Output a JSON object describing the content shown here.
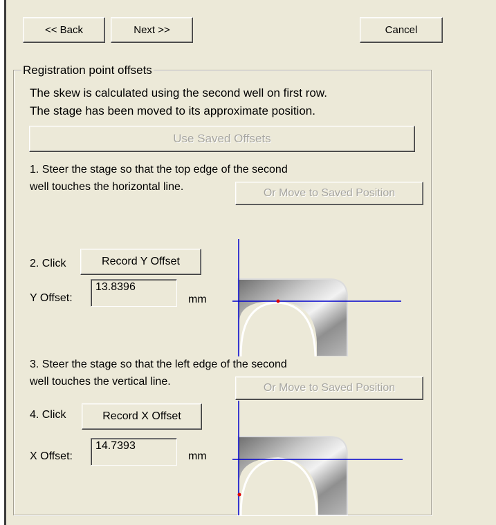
{
  "nav": {
    "back_label": "<< Back",
    "next_label": "Next >>",
    "cancel_label": "Cancel"
  },
  "group": {
    "title": "Registration point offsets",
    "intro_line1": "The skew is calculated using the second well on first row.",
    "intro_line2": "The stage has been moved to its approximate position.",
    "use_saved_label": "Use Saved Offsets"
  },
  "step1": {
    "line1": "1. Steer the stage so that the top edge of the second",
    "line2": "well touches the horizontal line.",
    "move_saved_label": "Or Move to Saved Position"
  },
  "step2": {
    "click_label": "2. Click",
    "record_label": "Record Y Offset",
    "offset_label": "Y Offset:",
    "offset_value": "13.8396",
    "unit": "mm"
  },
  "step3": {
    "line1": "3. Steer the stage so that the left edge of the second",
    "line2": "well touches the vertical line.",
    "move_saved_label": "Or Move to Saved Position"
  },
  "step4": {
    "click_label": "4. Click",
    "record_label": "Record X Offset",
    "offset_label": "X Offset:",
    "offset_value": "14.7393",
    "unit": "mm"
  },
  "colors": {
    "face": "#ECE9D8",
    "crosshair": "#0000cc",
    "marker": "#e00000",
    "disabled_text": "#a7a6a0"
  }
}
